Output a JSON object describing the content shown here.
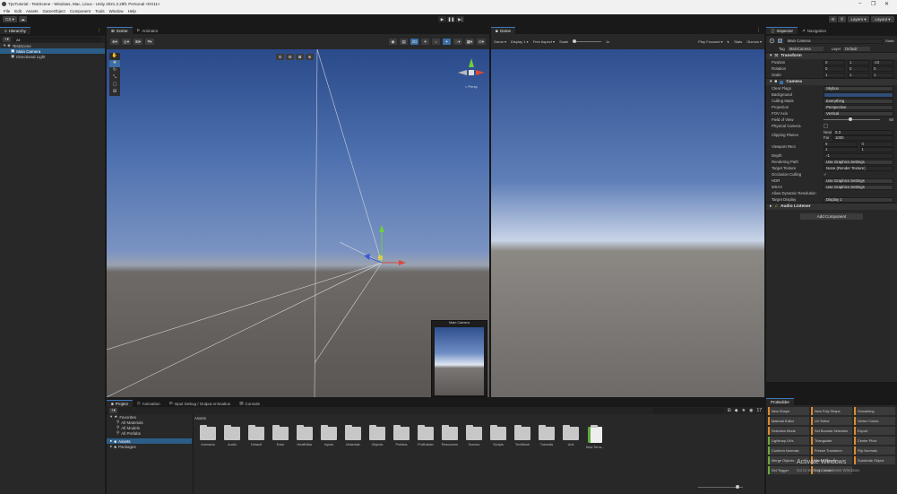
{
  "window": {
    "title": "TpvTutorial - TestScene - Windows, Mac, Linux - Unity 2021.3.29f1 Personal <DX11>",
    "controls": [
      "–",
      "❐",
      "✕"
    ]
  },
  "menu": [
    "File",
    "Edit",
    "Assets",
    "GameObject",
    "Component",
    "Tools",
    "Window",
    "Help"
  ],
  "toolbar": {
    "account": "CS ▾",
    "cloud": "☁",
    "play": "▶",
    "pause": "❚❚",
    "step": "▶|",
    "layers": "Layers ▾",
    "layout": "Layout ▾"
  },
  "hierarchy": {
    "tab": "Hierarchy",
    "search_placeholder": "All",
    "items": [
      {
        "label": "TestScene",
        "depth": 0
      },
      {
        "label": "Main Camera",
        "depth": 1
      },
      {
        "label": "Directional Light",
        "depth": 1
      }
    ]
  },
  "scene": {
    "tabs": [
      "Scene",
      "Animator"
    ],
    "camera_preview_title": "Main Camera",
    "persp_label": "< Persp"
  },
  "game": {
    "tab": "Game",
    "display": "Game ▾",
    "target": "Display 1 ▾",
    "aspect": "Free Aspect ▾",
    "scale_label": "Scale",
    "scale_value": "1x",
    "play_focused": "Play Focused ▾",
    "stats": "Stats",
    "gizmos": "Gizmos ▾"
  },
  "inspector": {
    "tabs": [
      "Inspector",
      "Navigation"
    ],
    "object_name": "Main Camera",
    "static_label": "Static",
    "tag_label": "Tag",
    "tag_value": "MainCamera",
    "layer_label": "Layer",
    "layer_value": "Default",
    "transform": {
      "title": "Transform",
      "rows": [
        {
          "label": "Position",
          "x": "0",
          "y": "1",
          "z": "-10"
        },
        {
          "label": "Rotation",
          "x": "0",
          "y": "0",
          "z": "0"
        },
        {
          "label": "Scale",
          "x": "1",
          "y": "1",
          "z": "1"
        }
      ]
    },
    "camera": {
      "title": "Camera",
      "rows": [
        {
          "label": "Clear Flags",
          "value": "Skybox"
        },
        {
          "label": "Background",
          "value": ""
        },
        {
          "label": "Culling Mask",
          "value": "Everything"
        },
        {
          "label": "Projection",
          "value": "Perspective"
        },
        {
          "label": "FOV Axis",
          "value": "Vertical"
        },
        {
          "label": "Field of View",
          "value": "60"
        },
        {
          "label": "Physical Camera",
          "value": ""
        },
        {
          "label": "Clipping Planes",
          "near": "0.3",
          "far": "1000"
        },
        {
          "label": "Viewport Rect",
          "x": "0",
          "y": "0",
          "w": "1",
          "h": "1"
        },
        {
          "label": "Depth",
          "value": "-1"
        },
        {
          "label": "Rendering Path",
          "value": "Use Graphics Settings"
        },
        {
          "label": "Target Texture",
          "value": "None (Render Texture)"
        },
        {
          "label": "Occlusion Culling",
          "value": "✓"
        },
        {
          "label": "HDR",
          "value": "Use Graphics Settings"
        },
        {
          "label": "MSAA",
          "value": "Use Graphics Settings"
        },
        {
          "label": "Allow Dynamic Resolution",
          "value": ""
        },
        {
          "label": "Target Display",
          "value": "Display 1"
        }
      ]
    },
    "audio_listener": "Audio Listener",
    "add_component": "Add Component"
  },
  "project": {
    "tabs": [
      "Project",
      "Animation",
      "Input Debug / Output Animation",
      "Console"
    ],
    "favorites": {
      "label": "Favorites",
      "items": [
        "All Materials",
        "All Models",
        "All Prefabs"
      ]
    },
    "tree": [
      "Assets",
      "Packages"
    ],
    "breadcrumb": "Assets",
    "folders": [
      "Animacio",
      "Audio",
      "Default",
      "Extor",
      "HealthBar",
      "Inputs",
      "Materials",
      "Objects",
      "Prefabs",
      "ProBuilder",
      "Resources",
      "Scenes",
      "Scripts",
      "TextMesh",
      "Tutorials",
      "Unit",
      "New Terra..."
    ],
    "hidden_count": "17"
  },
  "probuilder": {
    "tab": "ProBuilder",
    "buttons": [
      [
        "New Shape",
        "New Poly Shape",
        "Smoothing"
      ],
      [
        "Material Editor",
        "UV Editor",
        "Vertex Colors"
      ],
      [
        "Selection Mode",
        "Set Bounds Selection",
        "Export"
      ],
      [
        "Lightmap UVs",
        "Triangulate",
        "Center Pivot"
      ],
      [
        "Conform Normals",
        "Freeze Transform",
        "Flip Normals"
      ],
      [
        "Merge Objects",
        "Mirror Objects",
        "Subdivide Object"
      ],
      [
        "Set Trigger",
        "Set Collider",
        ""
      ]
    ],
    "watermark_title": "Activate Windows",
    "watermark_sub": "Go to Settings to activate Windows."
  }
}
